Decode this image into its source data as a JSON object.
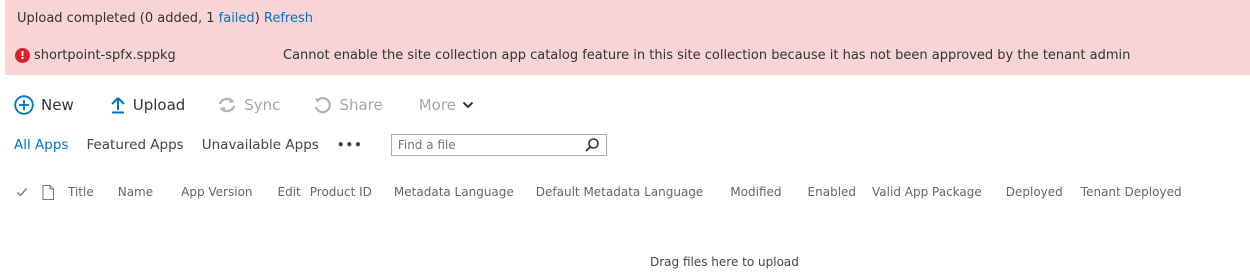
{
  "banner": {
    "status_prefix": "Upload completed (0 added, 1 ",
    "failed_link": "failed",
    "status_suffix": ")",
    "refresh_link": "Refresh",
    "error_icon": "error-circle-icon",
    "file_name": "shortpoint-spfx.sppkg",
    "error_message": "Cannot enable the site collection app catalog feature in this site collection because it has not been approved by the tenant admin",
    "background_color": "#f8d4d4",
    "error_color": "#d9232c"
  },
  "toolbar": {
    "new_label": "New",
    "upload_label": "Upload",
    "sync_label": "Sync",
    "share_label": "Share",
    "more_label": "More"
  },
  "views": {
    "items": [
      "All Apps",
      "Featured Apps",
      "Unavailable Apps"
    ],
    "more": "•••",
    "active": "All Apps"
  },
  "search": {
    "placeholder": "Find a file"
  },
  "columns": [
    "Title",
    "Name",
    "App Version",
    "Edit",
    "Product ID",
    "Metadata Language",
    "Default Metadata Language",
    "Modified",
    "Enabled",
    "Valid App Package",
    "Deployed",
    "Tenant Deployed"
  ],
  "drop_hint": "Drag files here to upload",
  "accent_color": "#0072c6"
}
